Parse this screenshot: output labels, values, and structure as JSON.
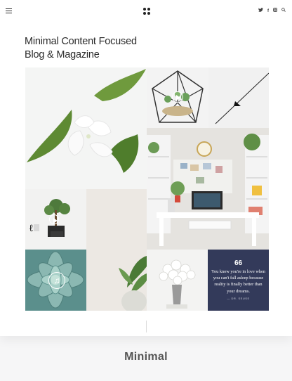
{
  "header": {
    "social_icons": [
      {
        "name": "twitter-icon",
        "glyph": "🐦"
      },
      {
        "name": "facebook-icon",
        "glyph": "f"
      },
      {
        "name": "instagram-icon",
        "glyph": "◎"
      },
      {
        "name": "search-icon",
        "glyph": "⌕"
      }
    ]
  },
  "hero": {
    "headline_line1": "Minimal Content Focused",
    "headline_line2": "Blog & Magazine"
  },
  "quote": {
    "mark": "66",
    "text": "You know you're in love when you can't fall asleep because reality is finally better than your dreams.",
    "author": "— DR. SEUSS"
  },
  "theme_label": "Minimal",
  "colors": {
    "quote_bg": "#333a5a",
    "succulent": "#5c9492",
    "text_dark": "#2b2b2b"
  }
}
